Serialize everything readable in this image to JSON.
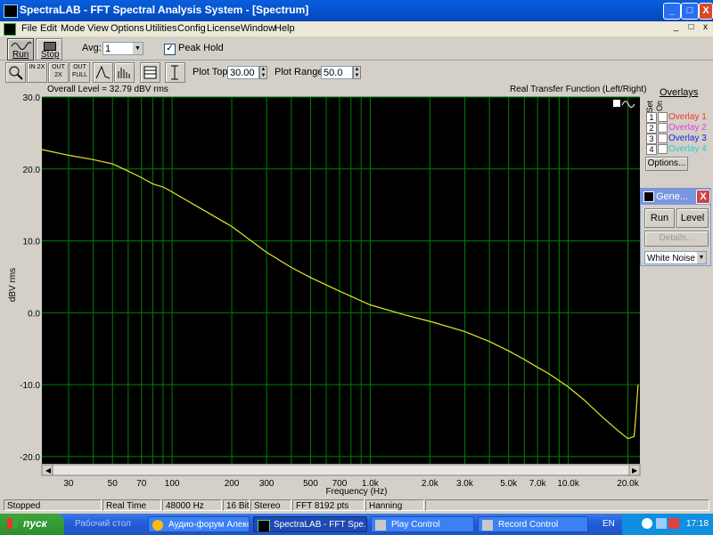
{
  "window": {
    "title": "SpectraLAB - FFT Spectral Analysis System - [Spectrum]",
    "controls": [
      "_",
      "□",
      "X"
    ],
    "mdi_controls": [
      "_",
      "□",
      "x"
    ]
  },
  "menu": [
    "File",
    "Edit",
    "Mode",
    "View",
    "Options",
    "Utilities",
    "Config",
    "License",
    "Window",
    "Help"
  ],
  "toolbar1": {
    "run_label": "Run",
    "stop_label": "Stop",
    "avg_label": "Avg:",
    "avg_value": "1",
    "peak_hold_label": "Peak Hold",
    "peak_hold_checked": true
  },
  "toolbar2": {
    "zoom_buttons": [
      "IN 2X",
      "OUT 2X",
      "OUT FULL"
    ],
    "plot_top_label": "Plot Top:",
    "plot_top_value": "30.00",
    "plot_range_label": "Plot Range:",
    "plot_range_value": "50.0"
  },
  "plot": {
    "overall_level": "Overall Level = 32.79 dBV rms",
    "mode": "Real Transfer Function (Left/Right)",
    "colors": {
      "background": "#000000",
      "grid": "#008000",
      "trace": "#e6e62a"
    }
  },
  "chart_data": {
    "type": "line",
    "title": "Real Transfer Function (Left/Right)",
    "xlabel": "Frequency (Hz)",
    "ylabel": "dBV rms",
    "x_scale": "log",
    "xlim": [
      22,
      23000
    ],
    "ylim": [
      -21,
      30
    ],
    "y_ticks": [
      "30.0",
      "20.0",
      "10.0",
      "0.0",
      "-10.0",
      "-20.0"
    ],
    "x_ticks": [
      "30",
      "50",
      "70",
      "100",
      "200",
      "300",
      "500",
      "700",
      "1.0k",
      "2.0k",
      "3.0k",
      "5.0k",
      "7.0k",
      "10.0k",
      "20.0k"
    ],
    "grid": true,
    "series": [
      {
        "x": [
          22,
          30,
          40,
          50,
          60,
          70,
          80,
          90,
          100,
          150,
          200,
          300,
          400,
          500,
          700,
          1000,
          1500,
          2000,
          3000,
          4000,
          5000,
          6000,
          7000,
          8000,
          10000,
          12000,
          15000,
          18000,
          20000,
          21500,
          22000,
          22500
        ],
        "y": [
          22.7,
          21.9,
          21.3,
          20.7,
          19.7,
          18.8,
          17.9,
          17.5,
          16.8,
          14.0,
          12.0,
          8.4,
          6.3,
          4.9,
          3.0,
          1.1,
          -0.3,
          -1.2,
          -2.6,
          -4.0,
          -5.3,
          -6.5,
          -7.6,
          -8.5,
          -10.3,
          -12.1,
          -14.6,
          -16.5,
          -17.5,
          -17.2,
          -14.0,
          -10.0
        ]
      }
    ]
  },
  "overlays": {
    "title": "Overlays",
    "set_label": "Set",
    "on_label": "On",
    "items": [
      {
        "num": "1",
        "label": "Overlay 1",
        "color": "#ff3030"
      },
      {
        "num": "2",
        "label": "Overlay 2",
        "color": "#e040e0"
      },
      {
        "num": "3",
        "label": "Overlay 3",
        "color": "#2020e0"
      },
      {
        "num": "4",
        "label": "Overlay 4",
        "color": "#20d0d0"
      }
    ],
    "options_label": "Options..."
  },
  "generator": {
    "title": "Gene...",
    "run_label": "Run",
    "level_label": "Level",
    "details_label": "Details...",
    "waveform": "White Noise"
  },
  "status": [
    "Stopped",
    "Real Time",
    "48000 Hz",
    "16 Bit",
    "Stereo",
    "FFT 8192 pts",
    "Hanning"
  ],
  "taskbar": {
    "start": "пуск",
    "tasks": [
      "Рабочий стол",
      "Аудио-форум Алекс...",
      "SpectraLAB - FFT Spe...",
      "Play Control",
      "Record Control"
    ],
    "lang": "EN",
    "clock": "17:18"
  }
}
